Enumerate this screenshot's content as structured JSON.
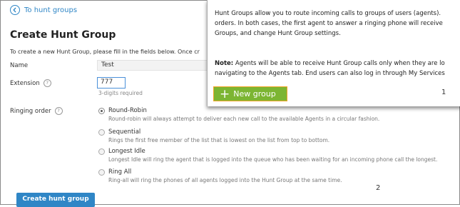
{
  "back_link": {
    "label": "To hunt groups"
  },
  "title": "Create Hunt Group",
  "intro": "To create a new Hunt Group, please fill in the fields below. Once cr",
  "fields": {
    "name_label": "Name",
    "name_value": "Test",
    "extension_label": "Extension",
    "extension_value": "777",
    "extension_hint": "3-digits required",
    "ringing_order_label": "Ringing order"
  },
  "ringing_options": [
    {
      "title": "Round-Robin",
      "desc": "Round-robin will always attempt to deliver each new call to the available Agents in a circular fashion.",
      "selected": true
    },
    {
      "title": "Sequential",
      "desc": "Rings the first free member of the list that is lowest on the list from top to bottom.",
      "selected": false
    },
    {
      "title": "Longest Idle",
      "desc": "Longest Idle will ring the agent that is logged into the queue who has been waiting for an incoming phone call the longest.",
      "selected": false
    },
    {
      "title": "Ring All",
      "desc": "Ring-all will ring the phones of all agents logged into the Hunt Group at the same time.",
      "selected": false
    }
  ],
  "create_button": "Create hunt group",
  "marker_2": "2",
  "overlay": {
    "line1": "Hunt Groups allow you to route incoming calls to groups of users (agents).",
    "line2": "orders. In both cases, the first agent to answer a ringing phone will receive",
    "line3": "Groups, and change Hunt Group settings.",
    "note_label": "Note:",
    "note_line1": " Agents will be able to receive Hunt Group calls only when they are lo",
    "note_line2": "navigating to the Agents tab. End users can also log in through My Services",
    "new_group_button": "New group",
    "marker_1": "1"
  },
  "colors": {
    "accent_blue": "#2f86c6",
    "green_button": "#7cb532",
    "highlight_orange": "#f2a527"
  }
}
